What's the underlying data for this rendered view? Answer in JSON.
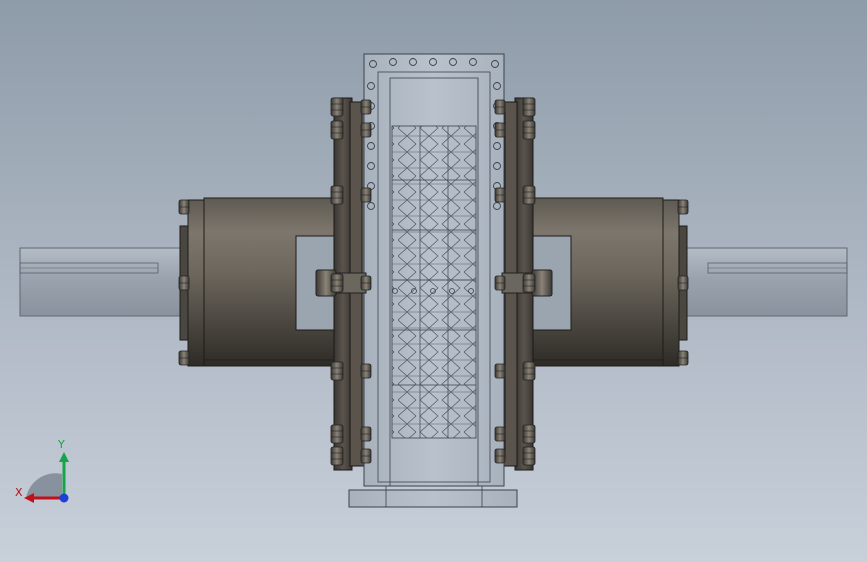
{
  "view": {
    "background_top": "#8e9ba9",
    "background_bottom": "#c8d0da"
  },
  "triad": {
    "x_label": "X",
    "y_label": "Y",
    "x_color": "#c0101a",
    "y_color": "#16a34a",
    "z_color": "#1d3fd6"
  }
}
